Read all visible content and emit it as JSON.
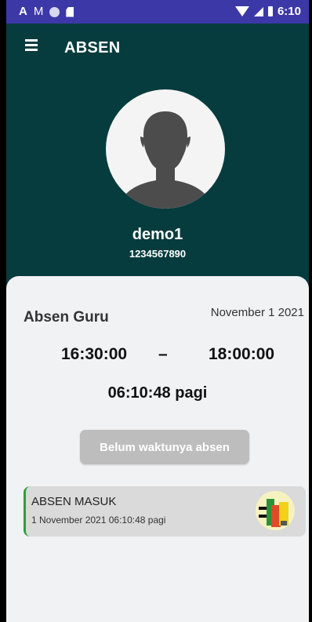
{
  "status_bar": {
    "left_icons": [
      "letter-a-icon",
      "mail-icon",
      "circle-icon",
      "sd-card-icon"
    ],
    "letter_a": "A",
    "mail_glyph": "M",
    "right_icons": [
      "wifi-icon",
      "signal-icon",
      "battery-icon"
    ],
    "time": "6:10",
    "color": "#3c38a8"
  },
  "app_bar": {
    "title": "ABSEN",
    "menu_icon": "hamburger-menu-icon",
    "color": "#063c3e"
  },
  "profile": {
    "avatar_icon": "default-avatar-icon",
    "name": "demo1",
    "id": "1234567890"
  },
  "attendance": {
    "title": "Absen Guru",
    "date": "November 1 2021",
    "start_time": "16:30:00",
    "separator": "–",
    "end_time": "18:00:00",
    "current_time": "06:10:48 pagi",
    "button_label": "Belum waktunya absen",
    "button_color": "#bdbdbd"
  },
  "log": [
    {
      "title": "ABSEN MASUK",
      "timestamp": "1 November 2021 06:10:48 pagi",
      "accent_color": "#2e9e40",
      "photo_icon": "attendance-photo-thumbnail"
    }
  ]
}
